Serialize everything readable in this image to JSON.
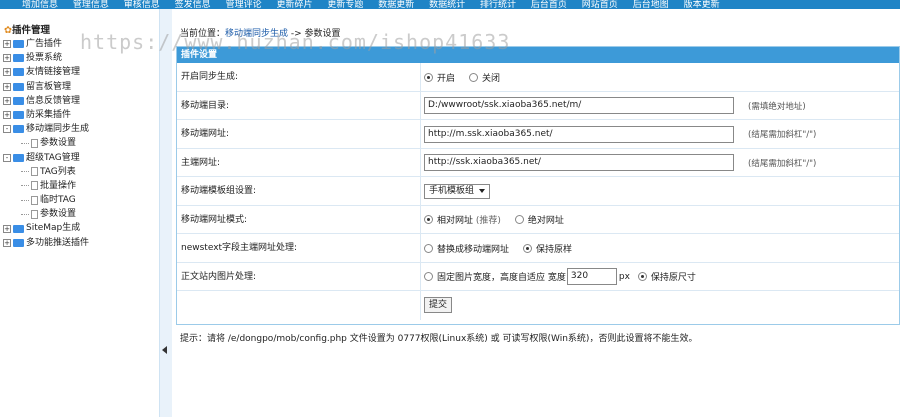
{
  "topnav": [
    "增加信息",
    "管理信息",
    "审核信息",
    "签发信息",
    "管理评论",
    "更新碎片",
    "更新专题",
    "数据更新",
    "数据统计",
    "排行统计",
    "后台首页",
    "网站首页",
    "后台地图",
    "版本更新"
  ],
  "sidebar": {
    "title": "插件管理",
    "items": [
      {
        "label": "广告插件",
        "type": "folder",
        "toggle": "+"
      },
      {
        "label": "投票系统",
        "type": "folder",
        "toggle": "+"
      },
      {
        "label": "友情链接管理",
        "type": "folder",
        "toggle": "+"
      },
      {
        "label": "留言板管理",
        "type": "folder",
        "toggle": "+"
      },
      {
        "label": "信息反馈管理",
        "type": "folder",
        "toggle": "+"
      },
      {
        "label": "防采集插件",
        "type": "folder",
        "toggle": "+"
      },
      {
        "label": "移动端同步生成",
        "type": "folder",
        "toggle": "-"
      },
      {
        "label": "参数设置",
        "type": "doc",
        "indent": 1
      },
      {
        "label": "超级TAG管理",
        "type": "folder",
        "toggle": "-"
      },
      {
        "label": "TAG列表",
        "type": "doc",
        "indent": 1
      },
      {
        "label": "批量操作",
        "type": "doc",
        "indent": 1
      },
      {
        "label": "临时TAG",
        "type": "doc",
        "indent": 1
      },
      {
        "label": "参数设置",
        "type": "doc",
        "indent": 1
      },
      {
        "label": "SiteMap生成",
        "type": "folder",
        "toggle": "+"
      },
      {
        "label": "多功能推送插件",
        "type": "folder",
        "toggle": "+"
      }
    ]
  },
  "breadcrumb": {
    "prefix": "当前位置：",
    "link": "移动端同步生成",
    "sep": " -> ",
    "current": "参数设置"
  },
  "watermark": "https://www.huzhan.com/ishop41633",
  "panel": {
    "title": "插件设置",
    "rows": {
      "sync": {
        "label": "开启同步生成:",
        "opt1": "开启",
        "opt2": "关闭"
      },
      "dir": {
        "label": "移动端目录:",
        "value": "D:/wwwroot/ssk.xiaoba365.net/m/",
        "hint": "(需填绝对地址)"
      },
      "mobile_url": {
        "label": "移动端网址:",
        "value": "http://m.ssk.xiaoba365.net/",
        "hint": "(结尾需加斜杠\"/\")"
      },
      "main_url": {
        "label": "主端网址:",
        "value": "http://ssk.xiaoba365.net/",
        "hint": "(结尾需加斜杠\"/\")"
      },
      "template": {
        "label": "移动端模板组设置:",
        "value": "手机模板组"
      },
      "url_mode": {
        "label": "移动端网址模式:",
        "opt1": "相对网址",
        "opt1_note": "(推荐)",
        "opt2": "绝对网址"
      },
      "newstext": {
        "label": "newstext字段主端网址处理:",
        "opt1": "替换成移动端网址",
        "opt2": "保持原样"
      },
      "img": {
        "label": "正文站内图片处理:",
        "opt1": "固定图片宽度，高度自适应 宽度",
        "width": "320",
        "unit": "px",
        "opt2": "保持原尺寸"
      }
    },
    "submit": "提交"
  },
  "note": "提示：请将 /e/dongpo/mob/config.php 文件设置为 0777权限(Linux系统) 或 可读写权限(Win系统)，否则此设置将不能生效。"
}
